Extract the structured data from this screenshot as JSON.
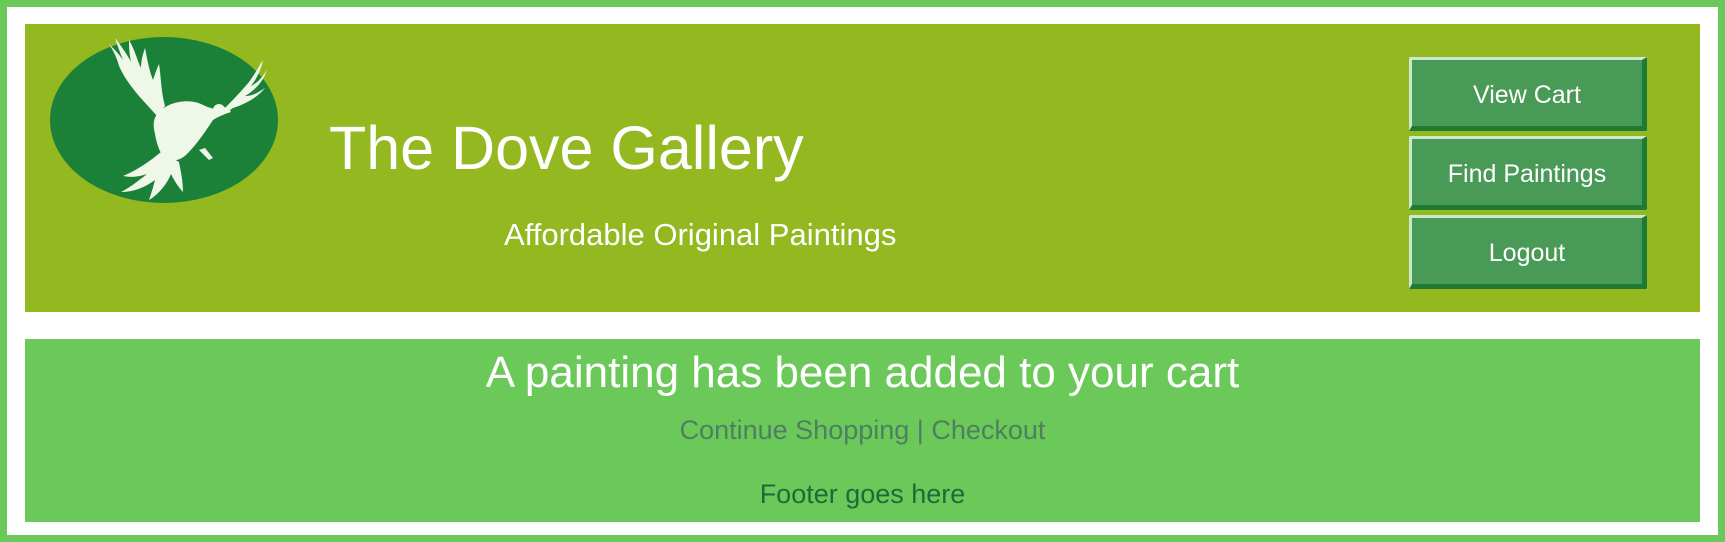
{
  "header": {
    "logo_icon": "dove-logo-icon",
    "title": "The Dove Gallery",
    "tagline": "Affordable Original Paintings"
  },
  "nav": {
    "view_cart": "View Cart",
    "find_paintings": "Find Paintings",
    "logout": "Logout"
  },
  "content": {
    "message": "A painting has been added to your cart",
    "continue_shopping": "Continue Shopping",
    "separator": "|",
    "checkout": "Checkout",
    "footer": "Footer goes here"
  },
  "colors": {
    "page_background": "#6bc95a",
    "header_background": "#93b820",
    "logo_oval": "#1b8038",
    "button_background": "#4a9a57",
    "content_background": "#6bc95a",
    "link_color": "#4f7f60",
    "footer_text": "#1e6b3a"
  }
}
